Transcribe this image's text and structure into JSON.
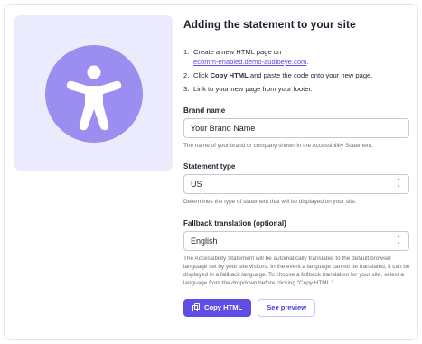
{
  "illustration": {
    "icon": "accessibility-icon",
    "bg_color": "#ecebfd",
    "circle_color": "#9c8ef0"
  },
  "title": "Adding the statement to your site",
  "steps": [
    {
      "num": "1.",
      "pre": "Create a new HTML page on",
      "link": "ecomm-enabled.demo-audioeye.com",
      "post": "."
    },
    {
      "num": "2.",
      "pre": "Click ",
      "bold": "Copy HTML",
      "post": " and paste the code onto your new page."
    },
    {
      "num": "3.",
      "text": "Link to your new page from your footer."
    }
  ],
  "brand": {
    "label": "Brand name",
    "value": "Your Brand Name",
    "help": "The name of your brand or company shown in the Accessibility Statement."
  },
  "statement_type": {
    "label": "Statement type",
    "value": "US",
    "help": "Determines the type of statement that will be displayed on your site."
  },
  "fallback": {
    "label": "Fallback translation (optional)",
    "value": "English",
    "help": "The Accessibility Statement will be automatically translated to the default browser language set by your site visitors. In the event a language cannot be translated, it can be displayed in a fallback language. To choose a fallback translation for your site, select a language from the dropdown before clicking \"Copy HTML.\""
  },
  "buttons": {
    "copy": "Copy HTML",
    "preview": "See preview"
  },
  "colors": {
    "accent": "#5f4ee6",
    "link": "#5a4ee6"
  }
}
